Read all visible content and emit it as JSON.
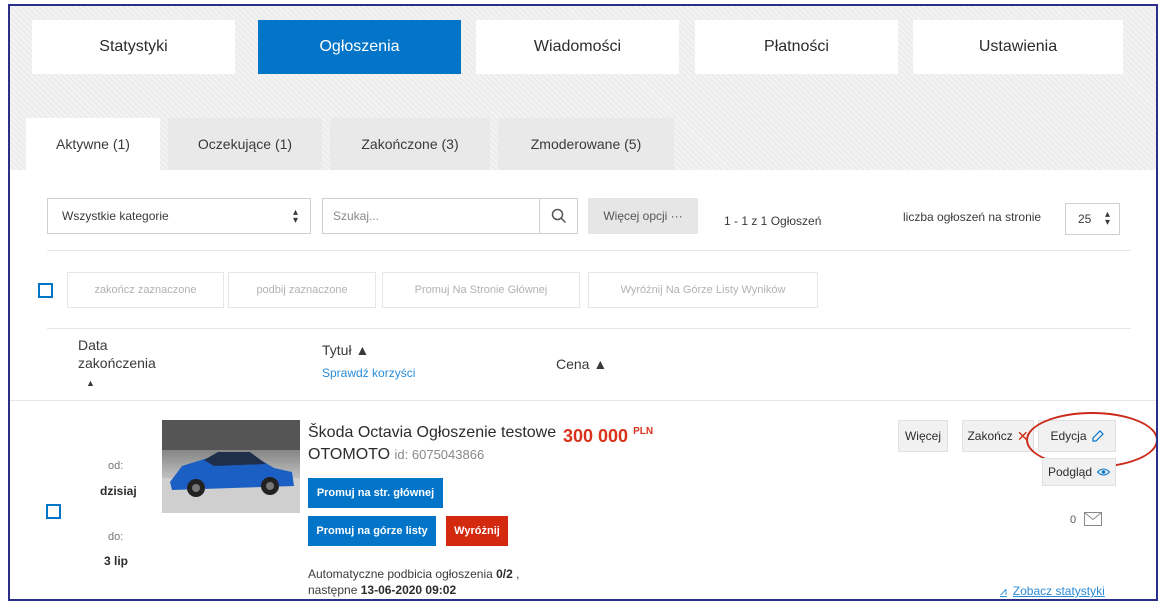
{
  "main_tabs": [
    {
      "label": "Statystyki",
      "active": false
    },
    {
      "label": "Ogłoszenia",
      "active": true
    },
    {
      "label": "Wiadomości",
      "active": false
    },
    {
      "label": "Płatności",
      "active": false
    },
    {
      "label": "Ustawienia",
      "active": false
    }
  ],
  "sub_tabs": [
    {
      "label": "Aktywne (1)",
      "active": true
    },
    {
      "label": "Oczekujące (1)",
      "active": false
    },
    {
      "label": "Zakończone (3)",
      "active": false
    },
    {
      "label": "Zmoderowane (5)",
      "active": false
    }
  ],
  "filters": {
    "category_value": "Wszystkie kategorie",
    "search_placeholder": "Szukaj...",
    "more_options_label": "Więcej opcji ···",
    "results_count": "1 - 1 z 1 Ogłoszeń",
    "per_page_label": "liczba ogłoszeń na stronie",
    "per_page_value": "25"
  },
  "bulk_actions": [
    "zakończ zaznaczone",
    "podbij zaznaczone",
    "Promuj Na Stronie Głównej",
    "Wyróżnij Na Górze Listy Wyników"
  ],
  "columns": {
    "end_date": "Data zakończenia",
    "title": "Tytuł ▲",
    "title_link": "Sprawdź korzyści",
    "price": "Cena ▲",
    "sort_arrow": "▲"
  },
  "listing": {
    "from_label": "od:",
    "from_value": "dzisiaj",
    "to_label": "do:",
    "to_value": "3 lip",
    "title": "Škoda Octavia Ogłoszenie testowe OTOMOTO",
    "ad_id": "id: 6075043866",
    "price": "300 000",
    "currency": "PLN",
    "promote_main": "Promuj na str. głównej",
    "promote_top": "Promuj na górze listy",
    "highlight": "Wyróżnij",
    "more": "Więcej",
    "end": "Zakończ",
    "edit": "Edycja",
    "preview": "Podgląd",
    "messages_count": "0",
    "auto_bump_prefix": "Automatyczne podbicia ogłoszenia ",
    "auto_bump_value": "0/2",
    "auto_bump_suffix": " ,",
    "next_prefix": "następne ",
    "next_value": "13-06-2020 09:02",
    "stats_link": "Zobacz statystyki"
  },
  "colors": {
    "accent_blue": "#0275c9",
    "promote_red": "#d3290f",
    "price_red": "#d8331b",
    "annotation_circle": "#cc2a1a",
    "frame": "#2b2f8a"
  }
}
